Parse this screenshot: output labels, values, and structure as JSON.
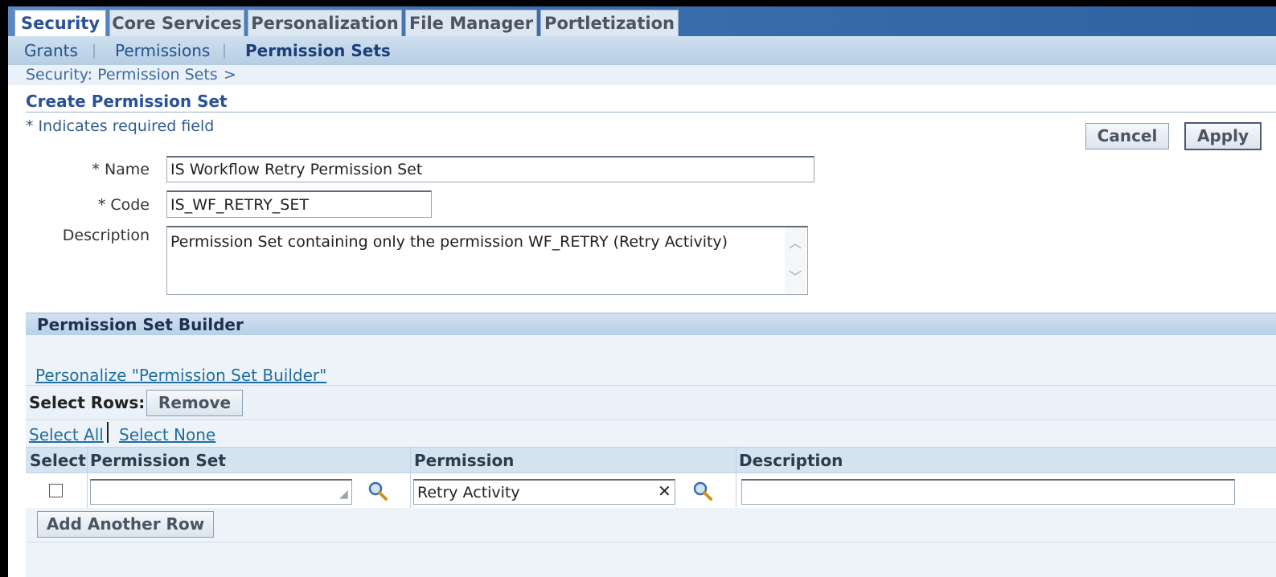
{
  "tabs": [
    {
      "label": "Security",
      "active": true
    },
    {
      "label": "Core Services",
      "active": false
    },
    {
      "label": "Personalization",
      "active": false
    },
    {
      "label": "File Manager",
      "active": false
    },
    {
      "label": "Portletization",
      "active": false
    }
  ],
  "subtabs": [
    {
      "label": "Grants",
      "active": false
    },
    {
      "label": "Permissions",
      "active": false
    },
    {
      "label": "Permission Sets",
      "active": true
    }
  ],
  "subtab_separator": "|",
  "breadcrumb": {
    "label": "Security: Permission Sets",
    "separator": ">"
  },
  "page": {
    "title": "Create Permission Set",
    "required_note": "* Indicates required field"
  },
  "buttons": {
    "cancel": "Cancel",
    "apply": "Apply"
  },
  "form": {
    "name_label": "* Name",
    "name_value": "IS Workflow Retry Permission Set",
    "code_label": "* Code",
    "code_value": "IS_WF_RETRY_SET",
    "description_label": "Description",
    "description_value": "Permission Set containing only the permission WF_RETRY (Retry Activity)"
  },
  "builder": {
    "title": "Permission Set Builder",
    "personalize_link": "Personalize \"Permission Set Builder\"",
    "select_rows_label": "Select Rows:",
    "remove_button": "Remove",
    "select_all": "Select All",
    "select_none": "Select None",
    "columns": [
      "Select",
      "Permission Set",
      "Permission",
      "Description"
    ],
    "row": {
      "selected": false,
      "permission_set": "",
      "permission": "Retry Activity",
      "description": ""
    },
    "add_row_button": "Add Another Row"
  },
  "colors": {
    "accent": "#2a5297",
    "link": "#1f6e9e",
    "tabbar": "#3b6fae"
  }
}
